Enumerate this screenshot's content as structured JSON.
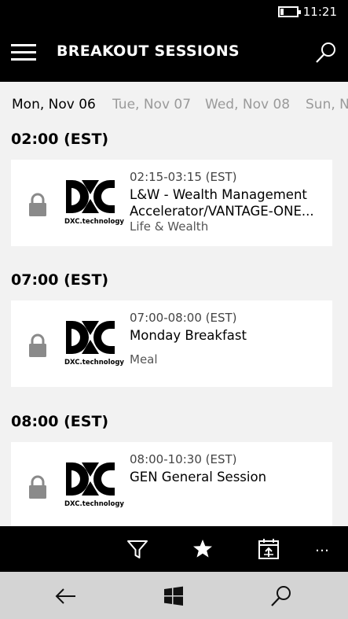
{
  "status_bar": {
    "time": "11:21",
    "battery_icon": "battery-icon"
  },
  "app_bar": {
    "title": "BREAKOUT SESSIONS",
    "menu_icon": "hamburger-icon",
    "search_icon": "search-icon"
  },
  "date_tabs": [
    {
      "label": "Mon, Nov 06",
      "active": true
    },
    {
      "label": "Tue, Nov 07",
      "active": false
    },
    {
      "label": "Wed, Nov 08",
      "active": false
    },
    {
      "label": "Sun, Nc",
      "active": false
    }
  ],
  "groups": [
    {
      "header": "02:00 (EST)",
      "session": {
        "time": "02:15-03:15 (EST)",
        "title": "L&W - Wealth Management Accelerator/VANTAGE-ONE...",
        "category": "Life & Wealth",
        "logo_text": "DXC.technology"
      }
    },
    {
      "header": "07:00 (EST)",
      "session": {
        "time": "07:00-08:00 (EST)",
        "title": "Monday Breakfast",
        "category": "Meal",
        "logo_text": "DXC.technology"
      }
    },
    {
      "header": "08:00 (EST)",
      "session": {
        "time": "08:00-10:30 (EST)",
        "title": "GEN General Session",
        "category": "",
        "logo_text": "DXC.technology"
      }
    }
  ],
  "command_bar": {
    "icons": [
      "filter-icon",
      "star-icon",
      "calendar-export-icon"
    ],
    "more_label": "…"
  },
  "nav_bar": {
    "icons": [
      "back-arrow-icon",
      "windows-icon",
      "search-icon"
    ]
  },
  "colors": {
    "bar_background": "#000000",
    "content_background": "#f2f2f2",
    "card_background": "#ffffff",
    "inactive_tab": "#9a9a9a",
    "lock": "#8a8a8a",
    "nav_background": "#d4d4d4"
  }
}
